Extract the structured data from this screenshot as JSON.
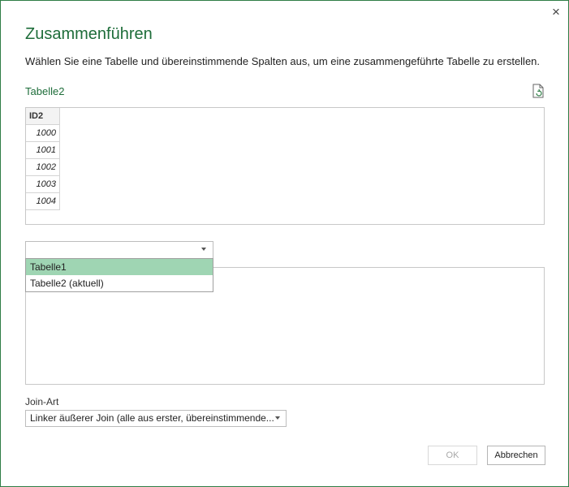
{
  "dialog": {
    "title": "Zusammenführen",
    "description": "Wählen Sie eine Tabelle und übereinstimmende Spalten aus, um eine zusammengeführte Tabelle zu erstellen.",
    "close_label": "×"
  },
  "first_table": {
    "label": "Tabelle2",
    "column_header": "ID2",
    "rows": [
      "1000",
      "1001",
      "1002",
      "1003",
      "1004"
    ]
  },
  "second_table": {
    "select_value": "",
    "dropdown_options": [
      "Tabelle1",
      "Tabelle2 (aktuell)"
    ],
    "highlighted_option": "Tabelle1"
  },
  "join": {
    "label": "Join-Art",
    "value": "Linker äußerer Join (alle aus erster, übereinstimmende..."
  },
  "buttons": {
    "ok": "OK",
    "cancel": "Abbrechen"
  },
  "colors": {
    "accent": "#1e6d3a",
    "highlight": "#9fd5b3"
  },
  "icons": {
    "refresh": "document-refresh-icon",
    "close": "close-icon"
  }
}
